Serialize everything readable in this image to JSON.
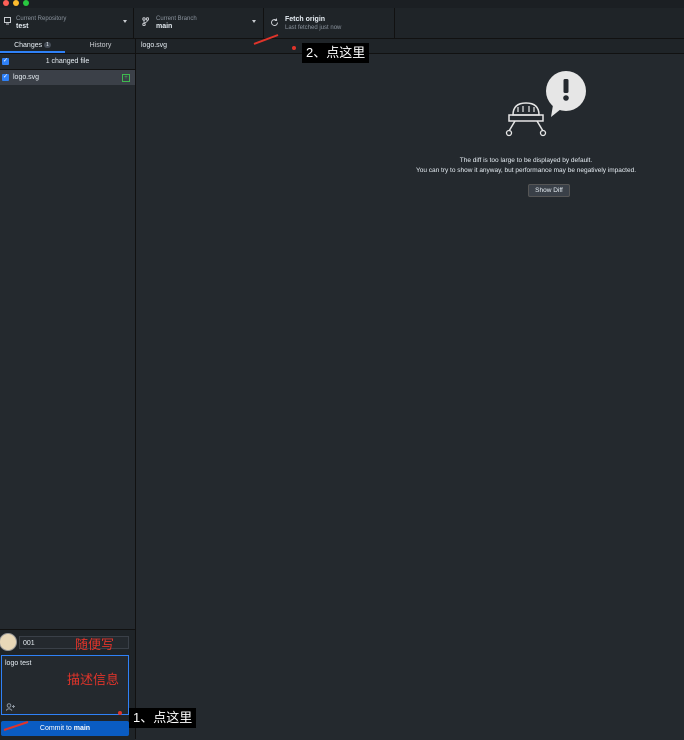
{
  "toolbar": {
    "repo": {
      "small": "Current Repository",
      "big": "test",
      "icon": "computer-icon"
    },
    "branch": {
      "small": "Current Branch",
      "big": "main",
      "icon": "branch-icon"
    },
    "fetch": {
      "big": "Fetch origin",
      "small": "Last fetched just now",
      "icon": "sync-icon"
    }
  },
  "sidebar": {
    "tabs": [
      {
        "label": "Changes",
        "badge": "1"
      },
      {
        "label": "History"
      }
    ],
    "changed_header": "1 changed file",
    "files": [
      {
        "name": "logo.svg",
        "status": "added"
      }
    ]
  },
  "commit": {
    "summary_value": "001",
    "description_value": "logo test",
    "button_prefix": "Commit to ",
    "button_branch": "main"
  },
  "main": {
    "file_name": "logo.svg",
    "diff_line1": "The diff is too large to be displayed by default.",
    "diff_line2": "You can try to show it anyway, but performance may be negatively impacted.",
    "show_diff_label": "Show Diff"
  },
  "annotations": {
    "step1": "1、点这里",
    "step2": "2、点这里",
    "summary_hint": "随便写",
    "desc_hint": "描述信息",
    "color": "#e0342a"
  }
}
